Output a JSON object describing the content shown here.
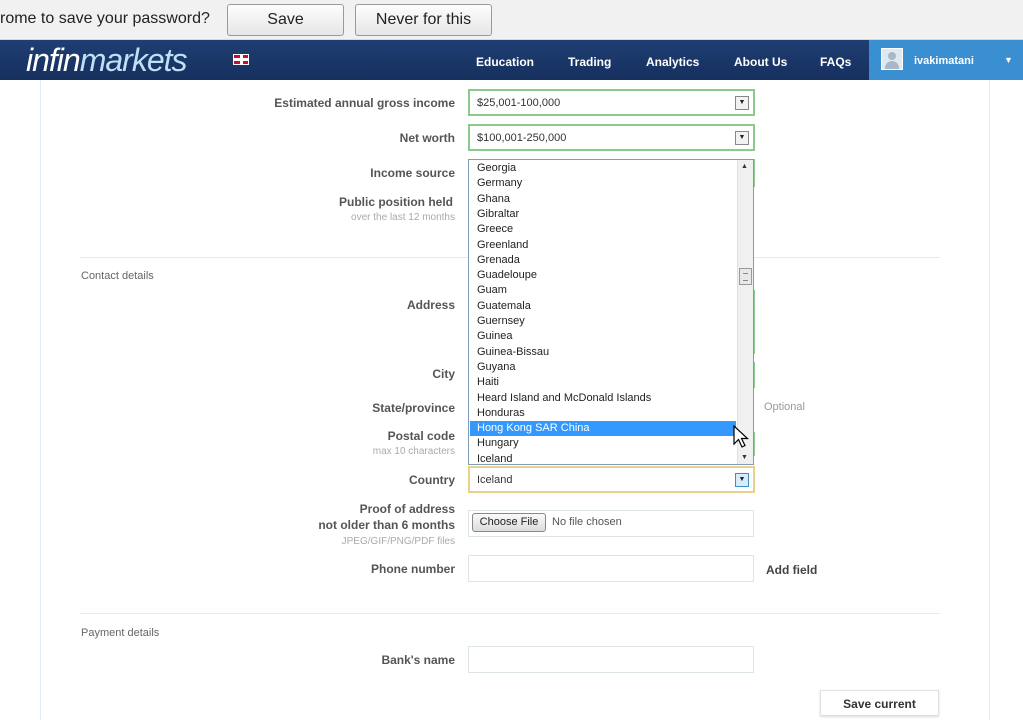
{
  "password_bar": {
    "message": "rome to save your password?",
    "save_label": "Save password",
    "never_label": "Never for this site"
  },
  "nav": {
    "logo_part1": "infin",
    "logo_part2": "markets",
    "links": [
      "Education",
      "Trading",
      "Analytics",
      "About Us",
      "FAQs"
    ],
    "username": "ivakimatani",
    "user_caret": "▼"
  },
  "form": {
    "income_label": "Estimated annual gross income",
    "income_value": "$25,001-100,000",
    "networth_label": "Net worth",
    "networth_value": "$100,001-250,000",
    "income_source_label": "Income source",
    "public_position_label": "Public position held",
    "public_position_sub": "over the last 12 months",
    "contact_section": "Contact details",
    "address_label": "Address",
    "city_label": "City",
    "state_label": "State/province",
    "state_optional": "Optional",
    "postal_label": "Postal code",
    "postal_sub": "max 10 characters",
    "country_label": "Country",
    "country_value": "Iceland",
    "proof_label_1": "Proof of address",
    "proof_label_2": "not older than 6 months",
    "proof_sub": "JPEG/GIF/PNG/PDF files",
    "choose_file": "Choose File",
    "no_file": "No file chosen",
    "phone_label": "Phone number",
    "add_field": "Add field",
    "payment_section": "Payment details",
    "bank_label": "Bank's name",
    "save_current": "Save current"
  },
  "country_dropdown": {
    "items": [
      "Georgia",
      "Germany",
      "Ghana",
      "Gibraltar",
      "Greece",
      "Greenland",
      "Grenada",
      "Guadeloupe",
      "Guam",
      "Guatemala",
      "Guernsey",
      "Guinea",
      "Guinea-Bissau",
      "Guyana",
      "Haiti",
      "Heard Island and McDonald Islands",
      "Honduras",
      "Hong Kong SAR China",
      "Hungary",
      "Iceland"
    ],
    "highlighted": "Hong Kong SAR China"
  },
  "colors": {
    "nav_bg": "#1f3e73",
    "user_box": "#3a8fd1",
    "valid_border": "#8cc98c",
    "highlight": "#3399ff"
  }
}
